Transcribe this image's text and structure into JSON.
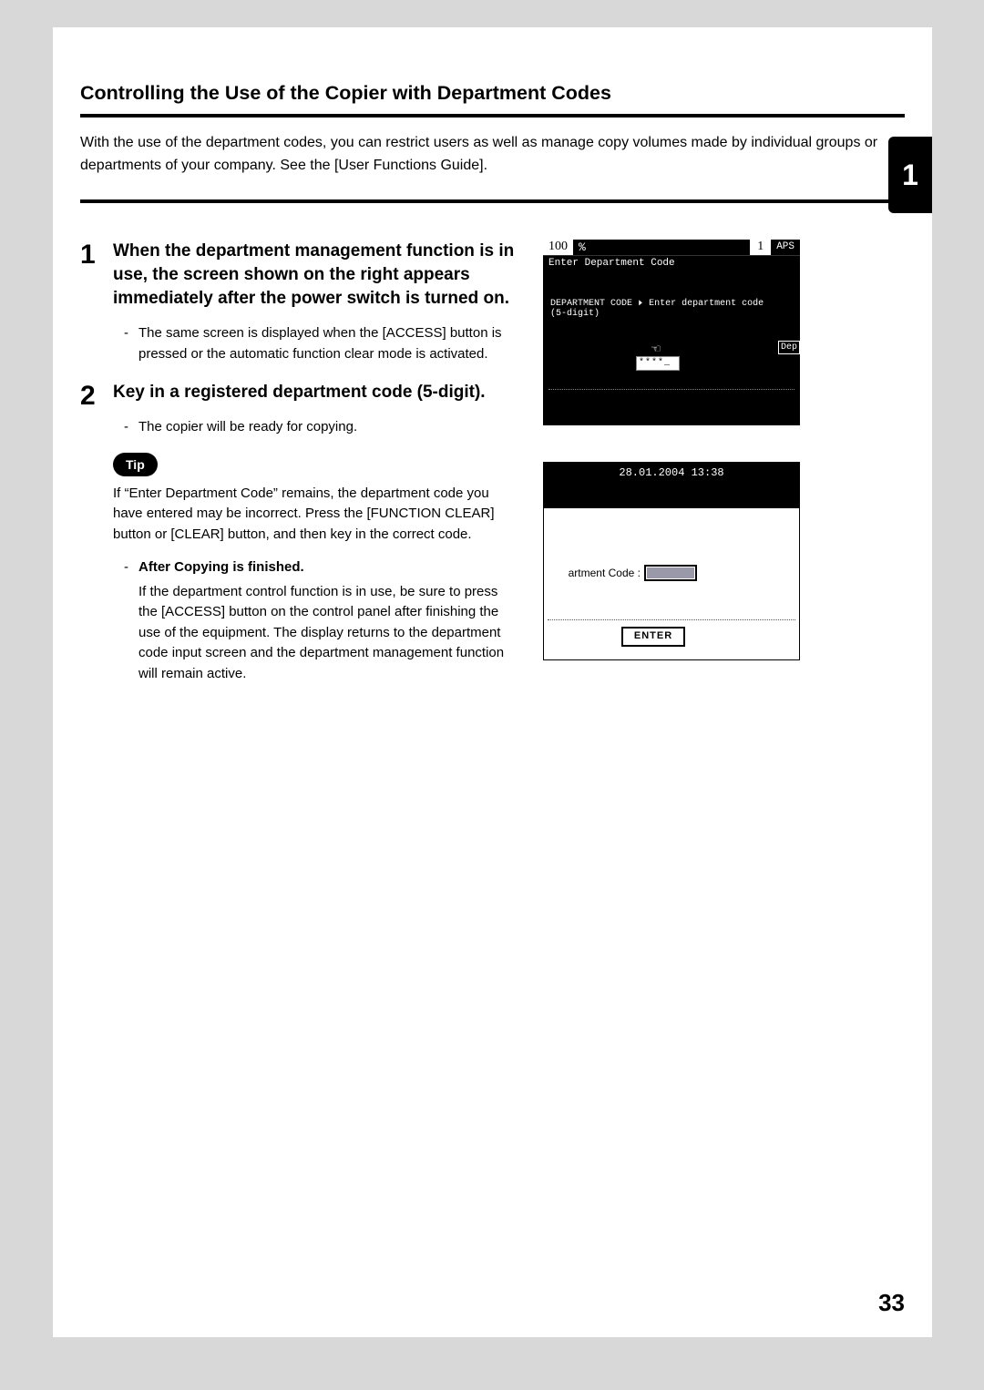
{
  "section_title": "Controlling the Use of the Copier with Department Codes",
  "intro": "With the use of the department codes, you can restrict users as well as manage copy volumes made by individual groups or departments of your company. See the [User Functions Guide].",
  "side_tab": "1",
  "page_number": "33",
  "steps": [
    {
      "num": "1",
      "head": "When the department management function is in use, the screen shown on the right appears immediately after the power switch is turned on.",
      "bullets": [
        "The same screen is displayed when the [ACCESS] button is pressed or the automatic function clear mode is activated."
      ]
    },
    {
      "num": "2",
      "head": "Key in a registered department code (5-digit).",
      "bullets": [
        "The copier will be ready for copying."
      ],
      "tip_label": "Tip",
      "tip_text": "If “Enter Department Code” remains, the department code you have entered may be incorrect. Press the [FUNCTION CLEAR] button or [CLEAR] button, and then key in the correct code.",
      "after_head": "After Copying is finished.",
      "after_text": "If the department control function is in use, be sure to press the [ACCESS] button on the control panel after finishing the use of the equipment. The display returns to the department code input screen and the department management function will remain active."
    }
  ],
  "screen1": {
    "zoom": "100",
    "pct": "%",
    "count": "1",
    "aps": "APS",
    "prompt": "Enter Department Code",
    "mid_left": "DEPARTMENT CODE",
    "mid_right": "Enter department code",
    "mid_sub": "(5-digit)",
    "input_mask": "****_",
    "dep_btn": "Dep"
  },
  "screen2": {
    "datetime": "28.01.2004 13:38",
    "label": "artment Code :",
    "enter": "ENTER"
  }
}
